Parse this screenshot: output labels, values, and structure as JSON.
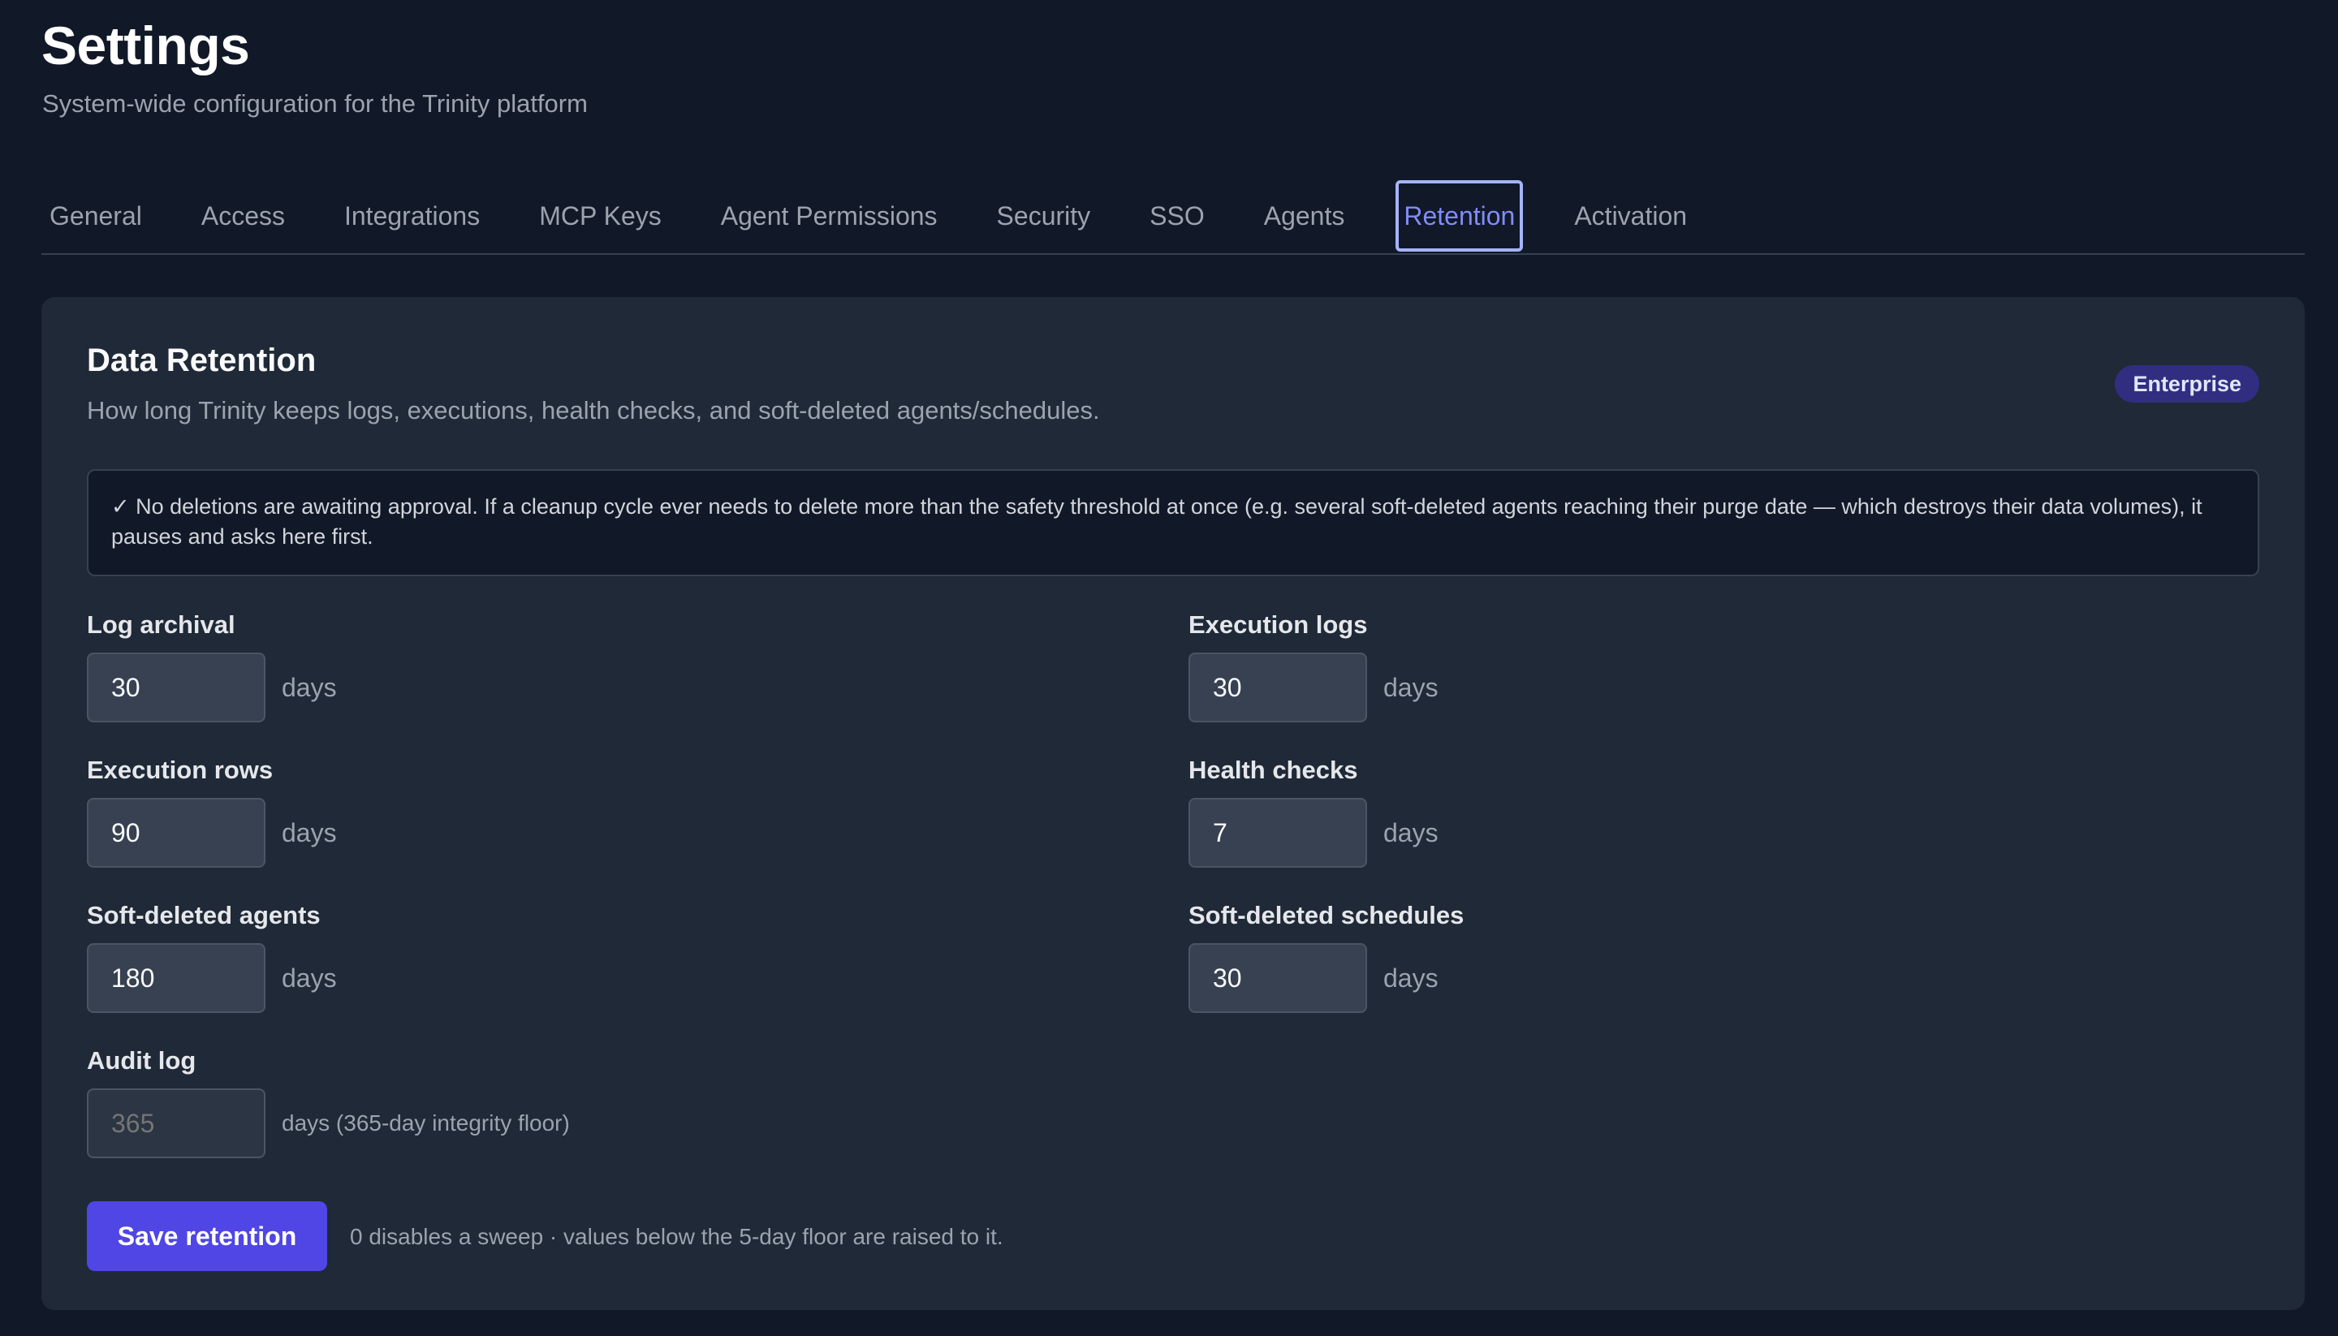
{
  "header": {
    "title": "Settings",
    "subtitle": "System-wide configuration for the Trinity platform"
  },
  "tabs": [
    {
      "label": "General",
      "active": false
    },
    {
      "label": "Access",
      "active": false
    },
    {
      "label": "Integrations",
      "active": false
    },
    {
      "label": "MCP Keys",
      "active": false
    },
    {
      "label": "Agent Permissions",
      "active": false
    },
    {
      "label": "Security",
      "active": false
    },
    {
      "label": "SSO",
      "active": false
    },
    {
      "label": "Agents",
      "active": false
    },
    {
      "label": "Retention",
      "active": true
    },
    {
      "label": "Activation",
      "active": false
    }
  ],
  "retention": {
    "title": "Data Retention",
    "description": "How long Trinity keeps logs, executions, health checks, and soft-deleted agents/schedules.",
    "badge": "Enterprise",
    "notice": "✓ No deletions are awaiting approval. If a cleanup cycle ever needs to delete more than the safety threshold at once (e.g. several soft-deleted agents reaching their purge date — which destroys their data volumes), it pauses and asks here first.",
    "fields": {
      "log_archival": {
        "label": "Log archival",
        "value": "30",
        "unit": "days"
      },
      "execution_logs": {
        "label": "Execution logs",
        "value": "30",
        "unit": "days"
      },
      "execution_rows": {
        "label": "Execution rows",
        "value": "90",
        "unit": "days"
      },
      "health_checks": {
        "label": "Health checks",
        "value": "7",
        "unit": "days"
      },
      "soft_deleted_agents": {
        "label": "Soft-deleted agents",
        "value": "180",
        "unit": "days"
      },
      "soft_deleted_schedules": {
        "label": "Soft-deleted schedules",
        "value": "30",
        "unit": "days"
      },
      "audit_log": {
        "label": "Audit log",
        "placeholder": "365",
        "unit": "days (365-day integrity floor)"
      }
    },
    "save_label": "Save retention",
    "save_hint": "0 disables a sweep · values below the 5-day floor are raised to it."
  },
  "colors": {
    "background": "#111827",
    "card": "#1f2937",
    "accent": "#4f46e5",
    "active_tab": "#818cf8",
    "badge_bg": "#312e81"
  }
}
